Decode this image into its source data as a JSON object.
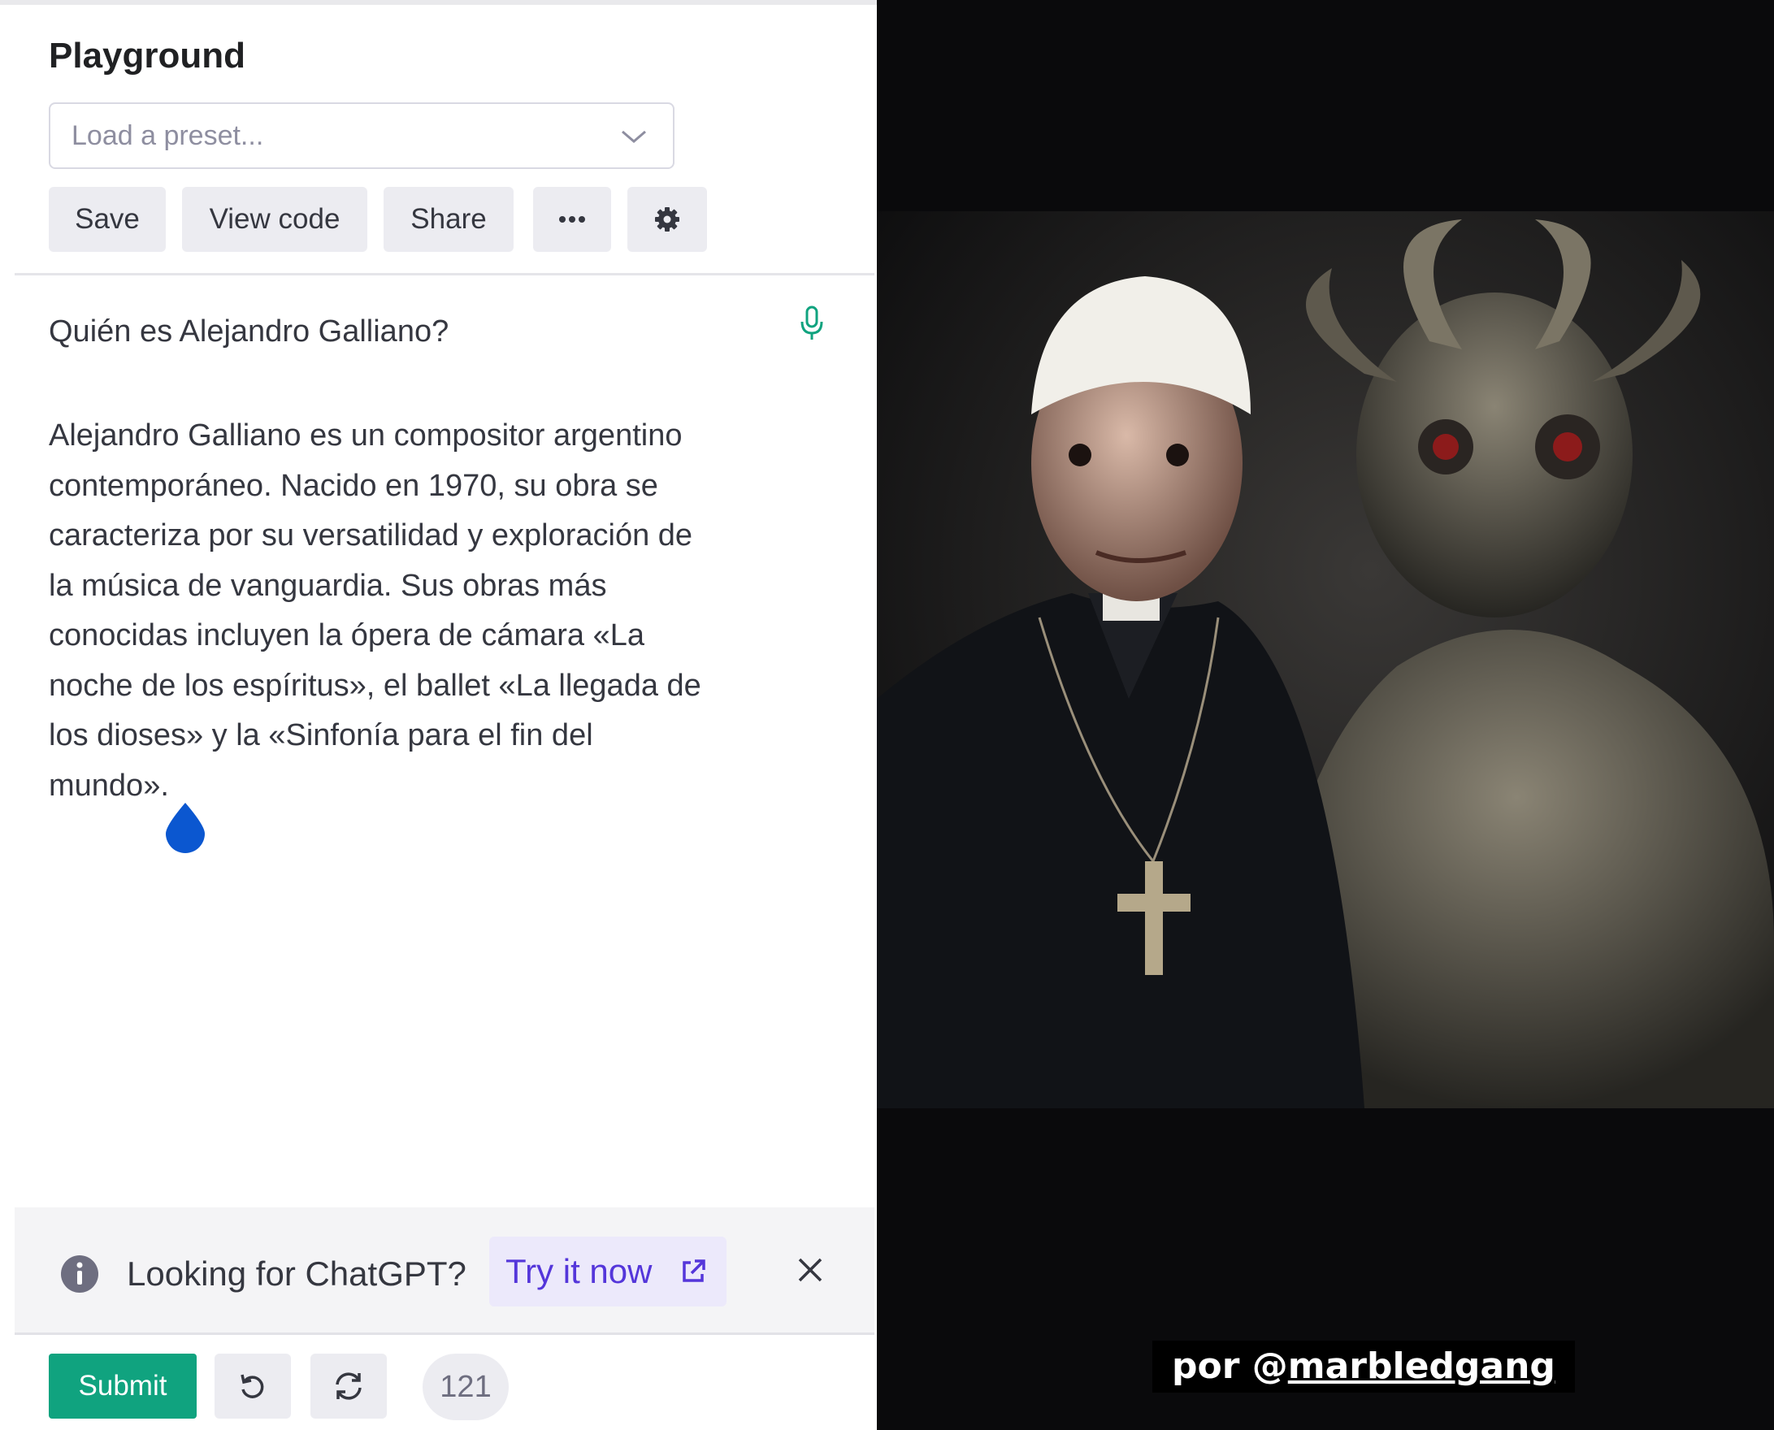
{
  "playground": {
    "title": "Playground",
    "preset_placeholder": "Load a preset...",
    "toolbar": {
      "save": "Save",
      "view_code": "View code",
      "share": "Share",
      "more_icon": "ellipsis-icon",
      "settings_icon": "gear-icon"
    },
    "prompt": "Quién es Alejandro Galliano?",
    "answer_lines": [
      "Alejandro Galliano es un compositor argentino",
      "contemporáneo. Nacido en 1970, su obra se",
      "caracteriza por su versatilidad y exploración de",
      "la música de vanguardia. Sus obras más",
      "conocidas incluyen la ópera de cámara «La",
      "noche de los espíritus», el ballet «La llegada de",
      "los dioses» y la «Sinfonía para el fin del",
      "mundo»."
    ],
    "banner": {
      "text": "Looking for ChatGPT?",
      "cta": "Try it now"
    },
    "submit": "Submit",
    "token_count": "121"
  },
  "overlay": {
    "caption_prefix": "por @",
    "caption_handle": "marbledgang"
  },
  "colors": {
    "accent_green": "#10a37f",
    "accent_purple": "#5436da",
    "drop_blue": "#0b57d0"
  }
}
